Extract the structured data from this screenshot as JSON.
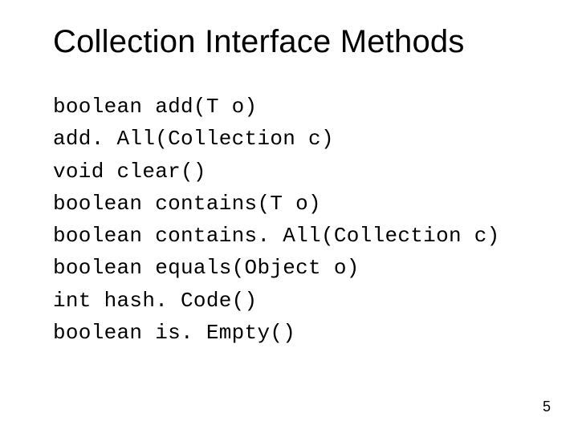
{
  "title": "Collection Interface Methods",
  "methods": [
    "boolean add(T o)",
    "add. All(Collection c)",
    "void clear()",
    "boolean contains(T o)",
    "boolean contains. All(Collection c)",
    "boolean equals(Object o)",
    "int hash. Code()",
    "boolean is. Empty()"
  ],
  "page_number": "5"
}
